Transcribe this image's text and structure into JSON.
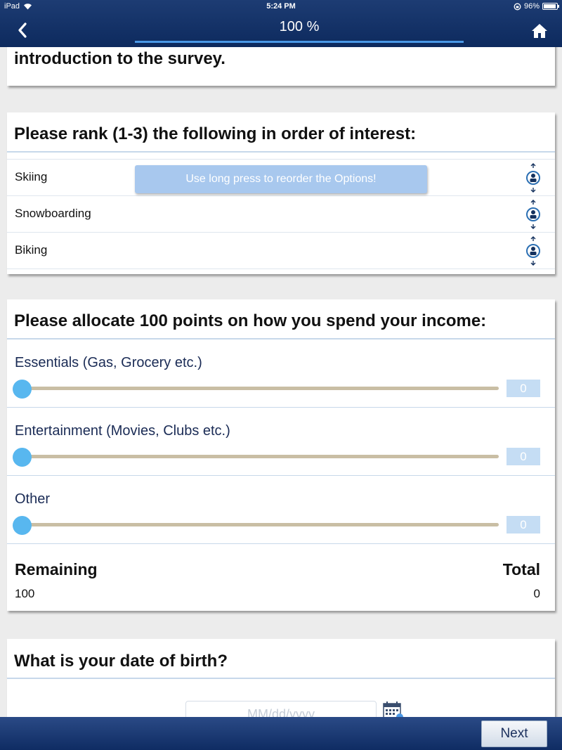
{
  "status_bar": {
    "device": "iPad",
    "time": "5:24 PM",
    "battery": "96%"
  },
  "nav": {
    "progress_label": "100 %",
    "progress_fraction": 1.0,
    "back_icon": "chevron-left-icon",
    "home_icon": "home-icon"
  },
  "intro_card": {
    "text": "introduction to the survey."
  },
  "rank_question": {
    "title": "Please rank (1-3) the following in order of interest:",
    "tooltip": "Use long press to reorder the Options!",
    "options": [
      {
        "label": "Skiing"
      },
      {
        "label": "Snowboarding"
      },
      {
        "label": "Biking"
      }
    ]
  },
  "allocate_question": {
    "title": "Please allocate 100 points on how you spend your income:",
    "items": [
      {
        "label": "Essentials (Gas, Grocery etc.)",
        "value": "0"
      },
      {
        "label": "Entertainment (Movies, Clubs etc.)",
        "value": "0"
      },
      {
        "label": "Other",
        "value": "0"
      }
    ],
    "remaining_label": "Remaining",
    "remaining_value": "100",
    "total_label": "Total",
    "total_value": "0"
  },
  "dob_question": {
    "title": "What is your date of birth?",
    "placeholder": "MM/dd/yyyy"
  },
  "footer": {
    "next_label": "Next"
  },
  "colors": {
    "header_bg": "#0d2a5e",
    "accent": "#4a98e6",
    "slider_thumb": "#58b7ef",
    "slider_track": "#c9bea4"
  }
}
